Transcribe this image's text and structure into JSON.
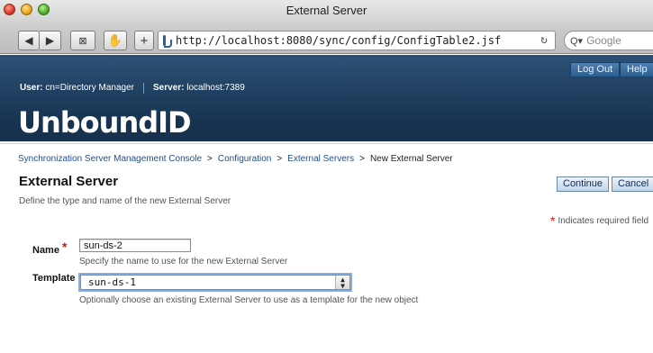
{
  "window": {
    "title": "External Server"
  },
  "toolbar": {
    "url": "http://localhost:8080/sync/config/ConfigTable2.jsf",
    "search_placeholder": "Google",
    "reload_glyph": "↻",
    "icons": [
      "back-icon",
      "forward-icon",
      "snapback-icon",
      "evernote-icon",
      "add-icon",
      "reload-icon",
      "search-icon"
    ]
  },
  "header": {
    "logout_label": "Log Out",
    "help_label": "Help",
    "user_label": "User:",
    "user_value": "cn=Directory Manager",
    "server_label": "Server:",
    "server_value": "localhost:7389",
    "logo_text": "UnboundID"
  },
  "breadcrumb": {
    "items": [
      "Synchronization Server Management Console",
      "Configuration",
      "External Servers"
    ],
    "current": "New External Server",
    "separator": ">"
  },
  "page": {
    "title": "External Server",
    "description": "Define the type and name of the new External Server",
    "continue_label": "Continue",
    "cancel_label": "Cancel",
    "required_note": "Indicates required field"
  },
  "form": {
    "name_label": "Name",
    "name_value": "sun-ds-2",
    "name_help": "Specify the name to use for the new External Server",
    "template_label": "Template",
    "template_value": "sun-ds-1",
    "template_help": "Optionally choose an existing External Server to use as a template for the new object"
  },
  "colors": {
    "header_bg": "#16324f",
    "link": "#1f4f8c",
    "required": "#d31515"
  }
}
